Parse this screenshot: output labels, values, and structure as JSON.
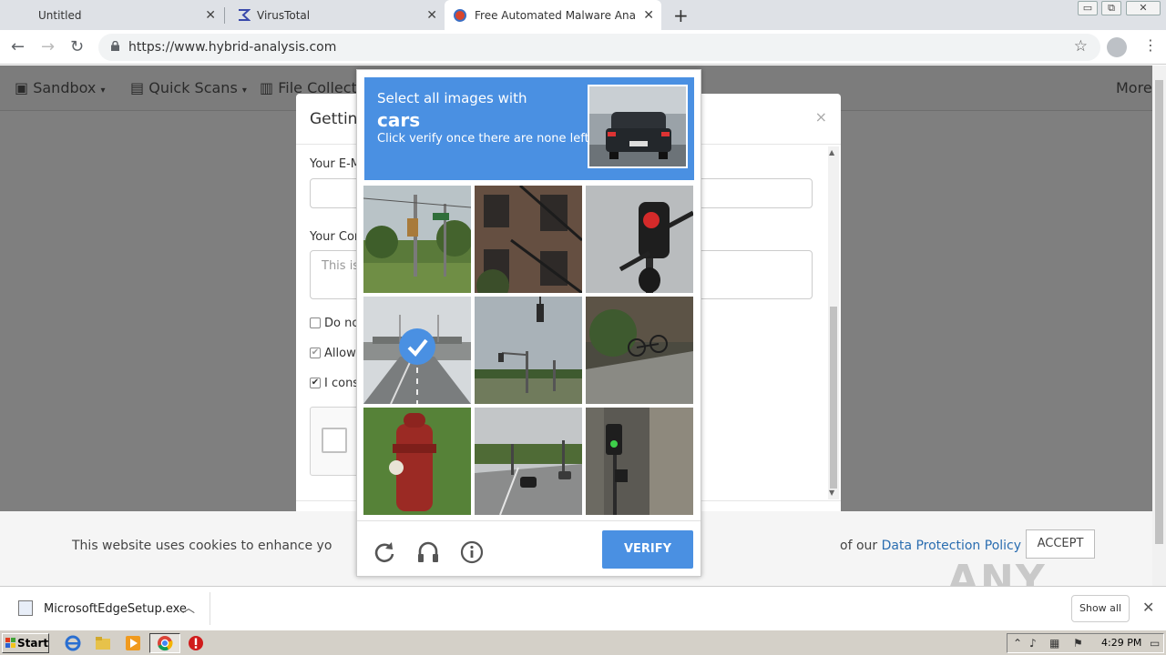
{
  "browser": {
    "tabs": [
      {
        "title": "Untitled",
        "active": false
      },
      {
        "title": "VirusTotal",
        "active": false
      },
      {
        "title": "Free Automated Malware Analysis Se",
        "active": true
      }
    ],
    "close_glyph": "✕",
    "new_tab_glyph": "+",
    "url": "https://www.hybrid-analysis.com",
    "window_buttons": {
      "minimize": "▭",
      "restore": "⧉",
      "close": "✕"
    }
  },
  "site": {
    "nav": {
      "sandbox": "Sandbox",
      "quick_scans": "Quick Scans",
      "file_collections": "File Collection",
      "more": "More"
    },
    "modal": {
      "title": "Getting",
      "close": "×",
      "email_label": "Your E-M",
      "comment_label": "Your Con",
      "comment_placeholder": "This is",
      "checkboxes": [
        {
          "label": "Do no",
          "checked": false
        },
        {
          "label": "Allow",
          "checked": true
        },
        {
          "label": "I cons",
          "checked": true
        }
      ]
    },
    "cookie": {
      "text": "This website uses cookies to enhance yo",
      "tail": "of our ",
      "link": "Data Protection Policy",
      "accept": "ACCEPT"
    },
    "watermark": "ANY RUN"
  },
  "recaptcha": {
    "prompt_pre": "Select all images with",
    "object": "cars",
    "instruction": "Click verify once there are none left",
    "tiles": [
      {
        "scene": "street-signs-trees",
        "selected": false
      },
      {
        "scene": "building-fire-escape",
        "selected": false
      },
      {
        "scene": "traffic-light-red",
        "selected": false
      },
      {
        "scene": "highway-overpass",
        "selected": true
      },
      {
        "scene": "traffic-light-intersection",
        "selected": false
      },
      {
        "scene": "bicycle-sidewalk",
        "selected": false
      },
      {
        "scene": "fire-hydrant",
        "selected": false
      },
      {
        "scene": "road-with-cars",
        "selected": false
      },
      {
        "scene": "traffic-light-green",
        "selected": false
      }
    ],
    "icons": [
      "reload-icon",
      "audio-icon",
      "info-icon"
    ],
    "verify_label": "VERIFY",
    "accent": "#4a90e2"
  },
  "downloads": {
    "file": "MicrosoftEdgeSetup.exe",
    "show_all": "Show all",
    "close": "✕"
  },
  "taskbar": {
    "start": "Start",
    "clock": "4:29 PM"
  }
}
